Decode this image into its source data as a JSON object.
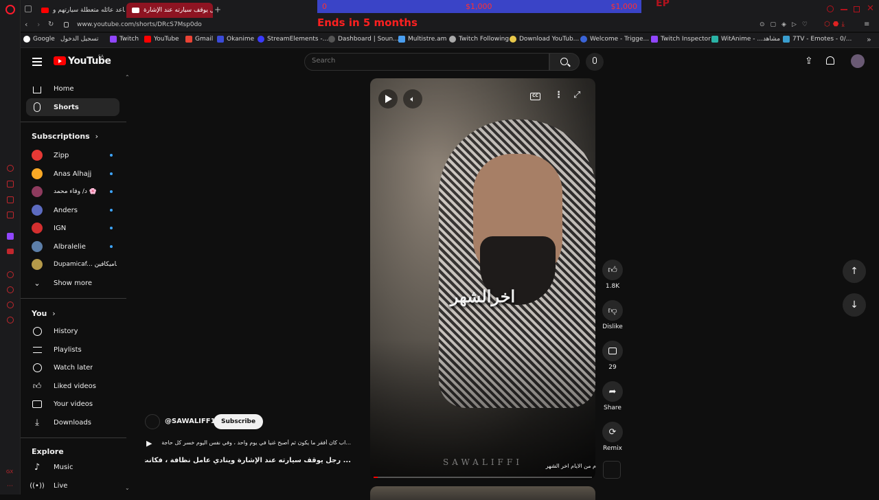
{
  "browser": {
    "tabs": [
      {
        "title": "ساعد عائله متعطلة سيارتهم و..."
      },
      {
        "title": "رجل يوقف سيارته عند الإشارة"
      }
    ],
    "url": "www.youtube.com/shorts/DRcS7Msp0do",
    "bookmarks": [
      {
        "label": "Google"
      },
      {
        "label": "تسجيل الدخول"
      },
      {
        "label": "Twitch"
      },
      {
        "label": "YouTube"
      },
      {
        "label": "Gmail"
      },
      {
        "label": "Okanime"
      },
      {
        "label": "StreamElements -..."
      },
      {
        "label": "Dashboard | Soun..."
      },
      {
        "label": "Multistre.am"
      },
      {
        "label": "Twitch Following"
      },
      {
        "label": "Download YouTub..."
      },
      {
        "label": "Welcome - Trigge..."
      },
      {
        "label": "Twitch Inspector"
      },
      {
        "label": "WitAnime - ...مشاهد"
      },
      {
        "label": "7TV - Emotes - 0/..."
      }
    ]
  },
  "overlay": {
    "goal_left": "0",
    "goal_mid": "$1,000",
    "goal_right": "$1,000",
    "ends": "Ends in 5 months",
    "corner": "EP"
  },
  "youtube": {
    "logo": "YouTube",
    "region": "SA",
    "search_placeholder": "Search",
    "nav_main": [
      {
        "label": "Home",
        "icon": "home-icon"
      },
      {
        "label": "Shorts",
        "icon": "shorts-icon",
        "active": true
      }
    ],
    "subscriptions_title": "Subscriptions",
    "subscriptions": [
      {
        "label": "Zipp",
        "color": "#e53935"
      },
      {
        "label": "Anas Alhajj",
        "color": "#f9a825"
      },
      {
        "label": "د/ وفاء محمد 🌸",
        "color": "#8e3b5e"
      },
      {
        "label": "Anders",
        "color": "#5c6bc0"
      },
      {
        "label": "IGN",
        "color": "#d32f2f"
      },
      {
        "label": "Albralelie",
        "color": "#5c7ea8"
      },
      {
        "label": "Dupamicaf... دوباميكافين",
        "color": "#b59a4a"
      }
    ],
    "show_more": "Show more",
    "you_title": "You",
    "you_items": [
      {
        "label": "History",
        "icon": "history-icon"
      },
      {
        "label": "Playlists",
        "icon": "playlists-icon"
      },
      {
        "label": "Watch later",
        "icon": "watch-later-icon"
      },
      {
        "label": "Liked videos",
        "icon": "liked-videos-icon"
      },
      {
        "label": "Your videos",
        "icon": "your-videos-icon"
      },
      {
        "label": "Downloads",
        "icon": "downloads-icon"
      }
    ],
    "explore_title": "Explore",
    "explore_items": [
      {
        "label": "Music",
        "icon": "music-icon"
      },
      {
        "label": "Live",
        "icon": "live-icon"
      }
    ],
    "short": {
      "overlay_text": "اخرالشهر",
      "watermark": "SAWALIFFI",
      "channel": "@SAWALIFF1",
      "subscribe": "Subscribe",
      "description": "...اب كان أفقر ما يكون ثم أصبح غنياً في يوم واحد ، وفي نفس اليوم خسر كل حاجة",
      "title": "... رجل يوقف سيارته عند الإشارة وينادي عامل نظافة ، فكانت النتيجة",
      "sound": "م من الايام اخر الشهر",
      "progress": 0.02
    },
    "actions": {
      "likes": "1.8K",
      "dislike": "Dislike",
      "comments": "29",
      "share": "Share",
      "remix": "Remix"
    }
  }
}
